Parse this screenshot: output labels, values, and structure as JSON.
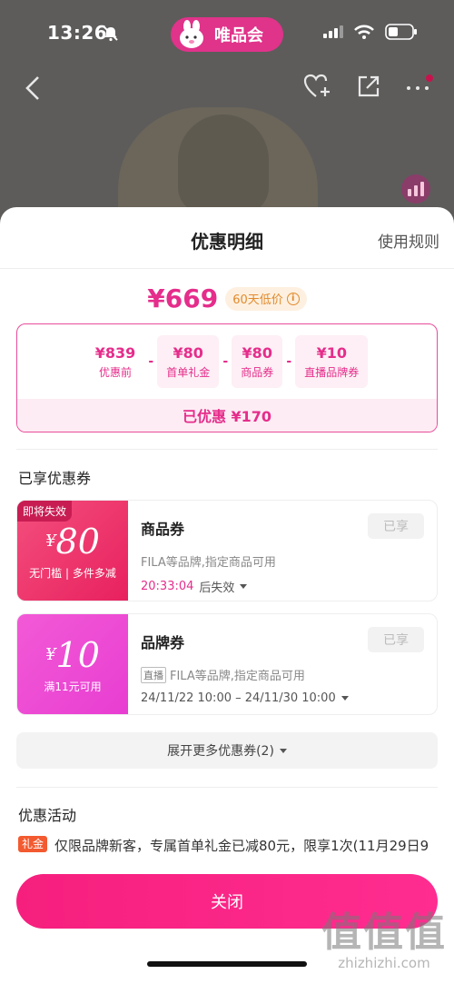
{
  "status_bar": {
    "time": "13:26",
    "brand": "唯品会"
  },
  "sheet": {
    "title": "优惠明细",
    "rules_link": "使用规则"
  },
  "price": {
    "final": "¥669",
    "badge": "60天低价",
    "info_glyph": "i"
  },
  "breakdown": {
    "items": [
      {
        "value": "¥839",
        "label": "优惠前"
      },
      {
        "value": "¥80",
        "label": "首单礼金"
      },
      {
        "value": "¥80",
        "label": "商品券"
      },
      {
        "value": "¥10",
        "label": "直播品牌券"
      }
    ],
    "operator": "-",
    "saved": "已优惠 ¥170"
  },
  "coupons_section": {
    "title": "已享优惠券"
  },
  "coupons": [
    {
      "tag": "即将失效",
      "currency": "¥",
      "amount": "80",
      "condition": "无门槛 | 多件多减",
      "name": "商品券",
      "desc": "FILA等品牌,指定商品可用",
      "time_highlight": "20:33:04",
      "time_suffix": "后失效",
      "status": "已享",
      "accent": "#e8205e"
    },
    {
      "currency": "¥",
      "amount": "10",
      "condition": "满11元可用",
      "name": "品牌券",
      "live_tag": "直播",
      "desc": "FILA等品牌,指定商品可用",
      "time_range": "24/11/22 10:00 – 24/11/30 10:00",
      "status": "已享",
      "accent": "#e83dd2"
    }
  ],
  "expand_more": "展开更多优惠券(2)",
  "promo_section": {
    "title": "优惠活动",
    "tag": "礼金",
    "text": "仅限品牌新客，专属首单礼金已减80元，限享1次(11月29日9"
  },
  "close_button": "关闭",
  "watermark": {
    "big": "值值值",
    "small": "zhizhizhi.com"
  },
  "colors": {
    "brand_pink": "#e52d8b",
    "close_gradient": "#f61f7e"
  }
}
